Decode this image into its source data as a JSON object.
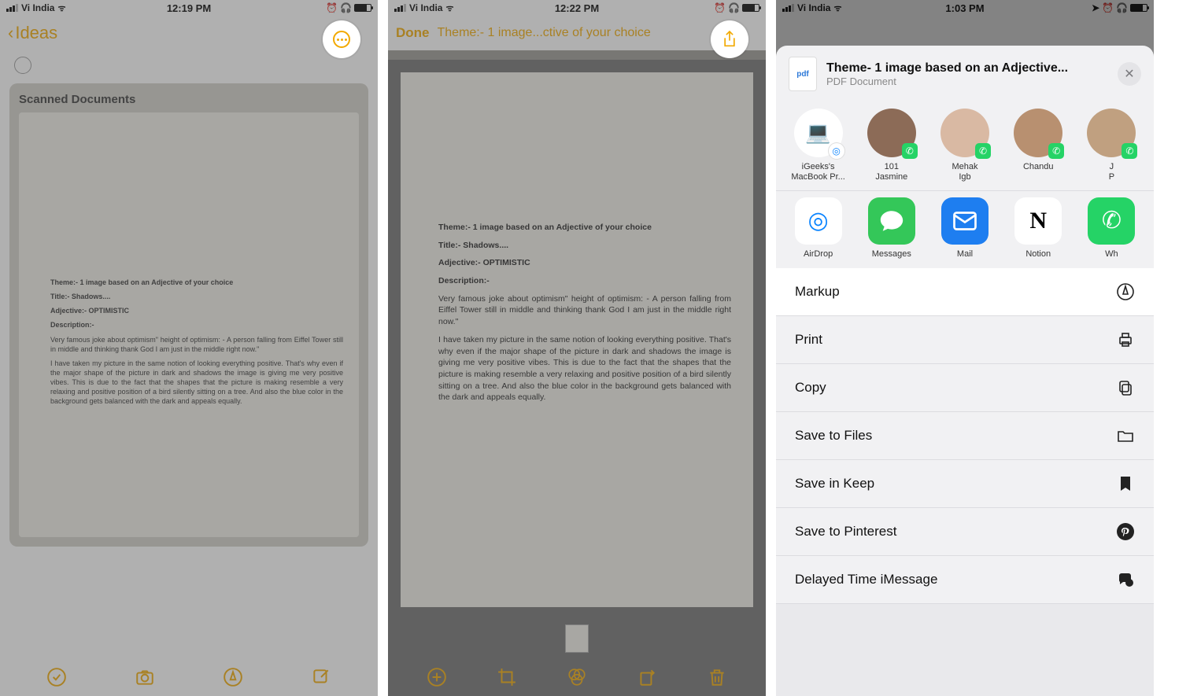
{
  "screen1": {
    "status": {
      "carrier": "Vi India",
      "time": "12:19 PM"
    },
    "nav": {
      "back_label": "Ideas"
    },
    "card_title": "Scanned Documents",
    "doc": {
      "l1": "Theme:-  1 image based on an Adjective of your choice",
      "l2": "Title:-  Shadows....",
      "l3": "Adjective:- OPTIMISTIC",
      "l4": "Description:-",
      "p1": "Very famous joke about optimism\" height of optimism: - A person falling from Eiffel Tower still in middle and thinking thank God I am just in the middle right now.\"",
      "p2": "I have taken my picture in the same notion of looking everything positive. That's why even if the major shape of the picture in dark and shadows the image is giving me very positive vibes. This is due to the fact that the shapes that the picture is making resemble a very relaxing and positive position of a bird silently sitting on a tree.  And also the blue color in the background gets balanced with the dark and appeals equally."
    }
  },
  "screen2": {
    "status": {
      "carrier": "Vi India",
      "time": "12:22 PM"
    },
    "nav": {
      "done": "Done",
      "title": "Theme:- 1 image...ctive of your choice"
    },
    "doc": {
      "l1": "Theme:-  1 image based on an Adjective of your choice",
      "l2": "Title:-  Shadows....",
      "l3": "Adjective:- OPTIMISTIC",
      "l4": "Description:-",
      "p1": "Very famous joke about optimism\" height of optimism: - A person falling from Eiffel Tower still in middle and thinking thank God I am just in the middle right now.\"",
      "p2": "I have taken my picture in the same notion of looking everything positive. That's why even if the major shape of the picture in dark and shadows the image is giving me very positive vibes. This is due to the fact that the shapes that the picture is making resemble a very relaxing and positive position of a bird silently sitting on a tree.  And also the blue color in the background gets balanced with the dark and appeals equally."
    }
  },
  "screen3": {
    "status": {
      "carrier": "Vi India",
      "time": "1:03 PM"
    },
    "sheet": {
      "badge": "pdf",
      "title": "Theme- 1 image based on an Adjective...",
      "subtitle": "PDF Document"
    },
    "contacts": [
      {
        "name_l1": "iGeeks's",
        "name_l2": "MacBook Pr...",
        "kind": "airdrop"
      },
      {
        "name_l1": "101",
        "name_l2": "Jasmine",
        "kind": "wa"
      },
      {
        "name_l1": "Mehak",
        "name_l2": "Igb",
        "kind": "wa"
      },
      {
        "name_l1": "Chandu",
        "name_l2": "",
        "kind": "wa"
      },
      {
        "name_l1": "J",
        "name_l2": "P",
        "kind": "wa"
      }
    ],
    "apps": [
      {
        "label": "AirDrop",
        "cls": "ic-airdrop",
        "glyph": "◎"
      },
      {
        "label": "Messages",
        "cls": "ic-msg",
        "glyph": "💬"
      },
      {
        "label": "Mail",
        "cls": "ic-mail",
        "glyph": "✉"
      },
      {
        "label": "Notion",
        "cls": "ic-notion",
        "glyph": "N"
      },
      {
        "label": "Wh",
        "cls": "ic-msg",
        "glyph": ""
      }
    ],
    "actions": {
      "markup": "Markup",
      "print": "Print",
      "copy": "Copy",
      "save_files": "Save to Files",
      "save_keep": "Save in Keep",
      "save_pin": "Save to Pinterest",
      "delayed": "Delayed Time iMessage"
    }
  }
}
